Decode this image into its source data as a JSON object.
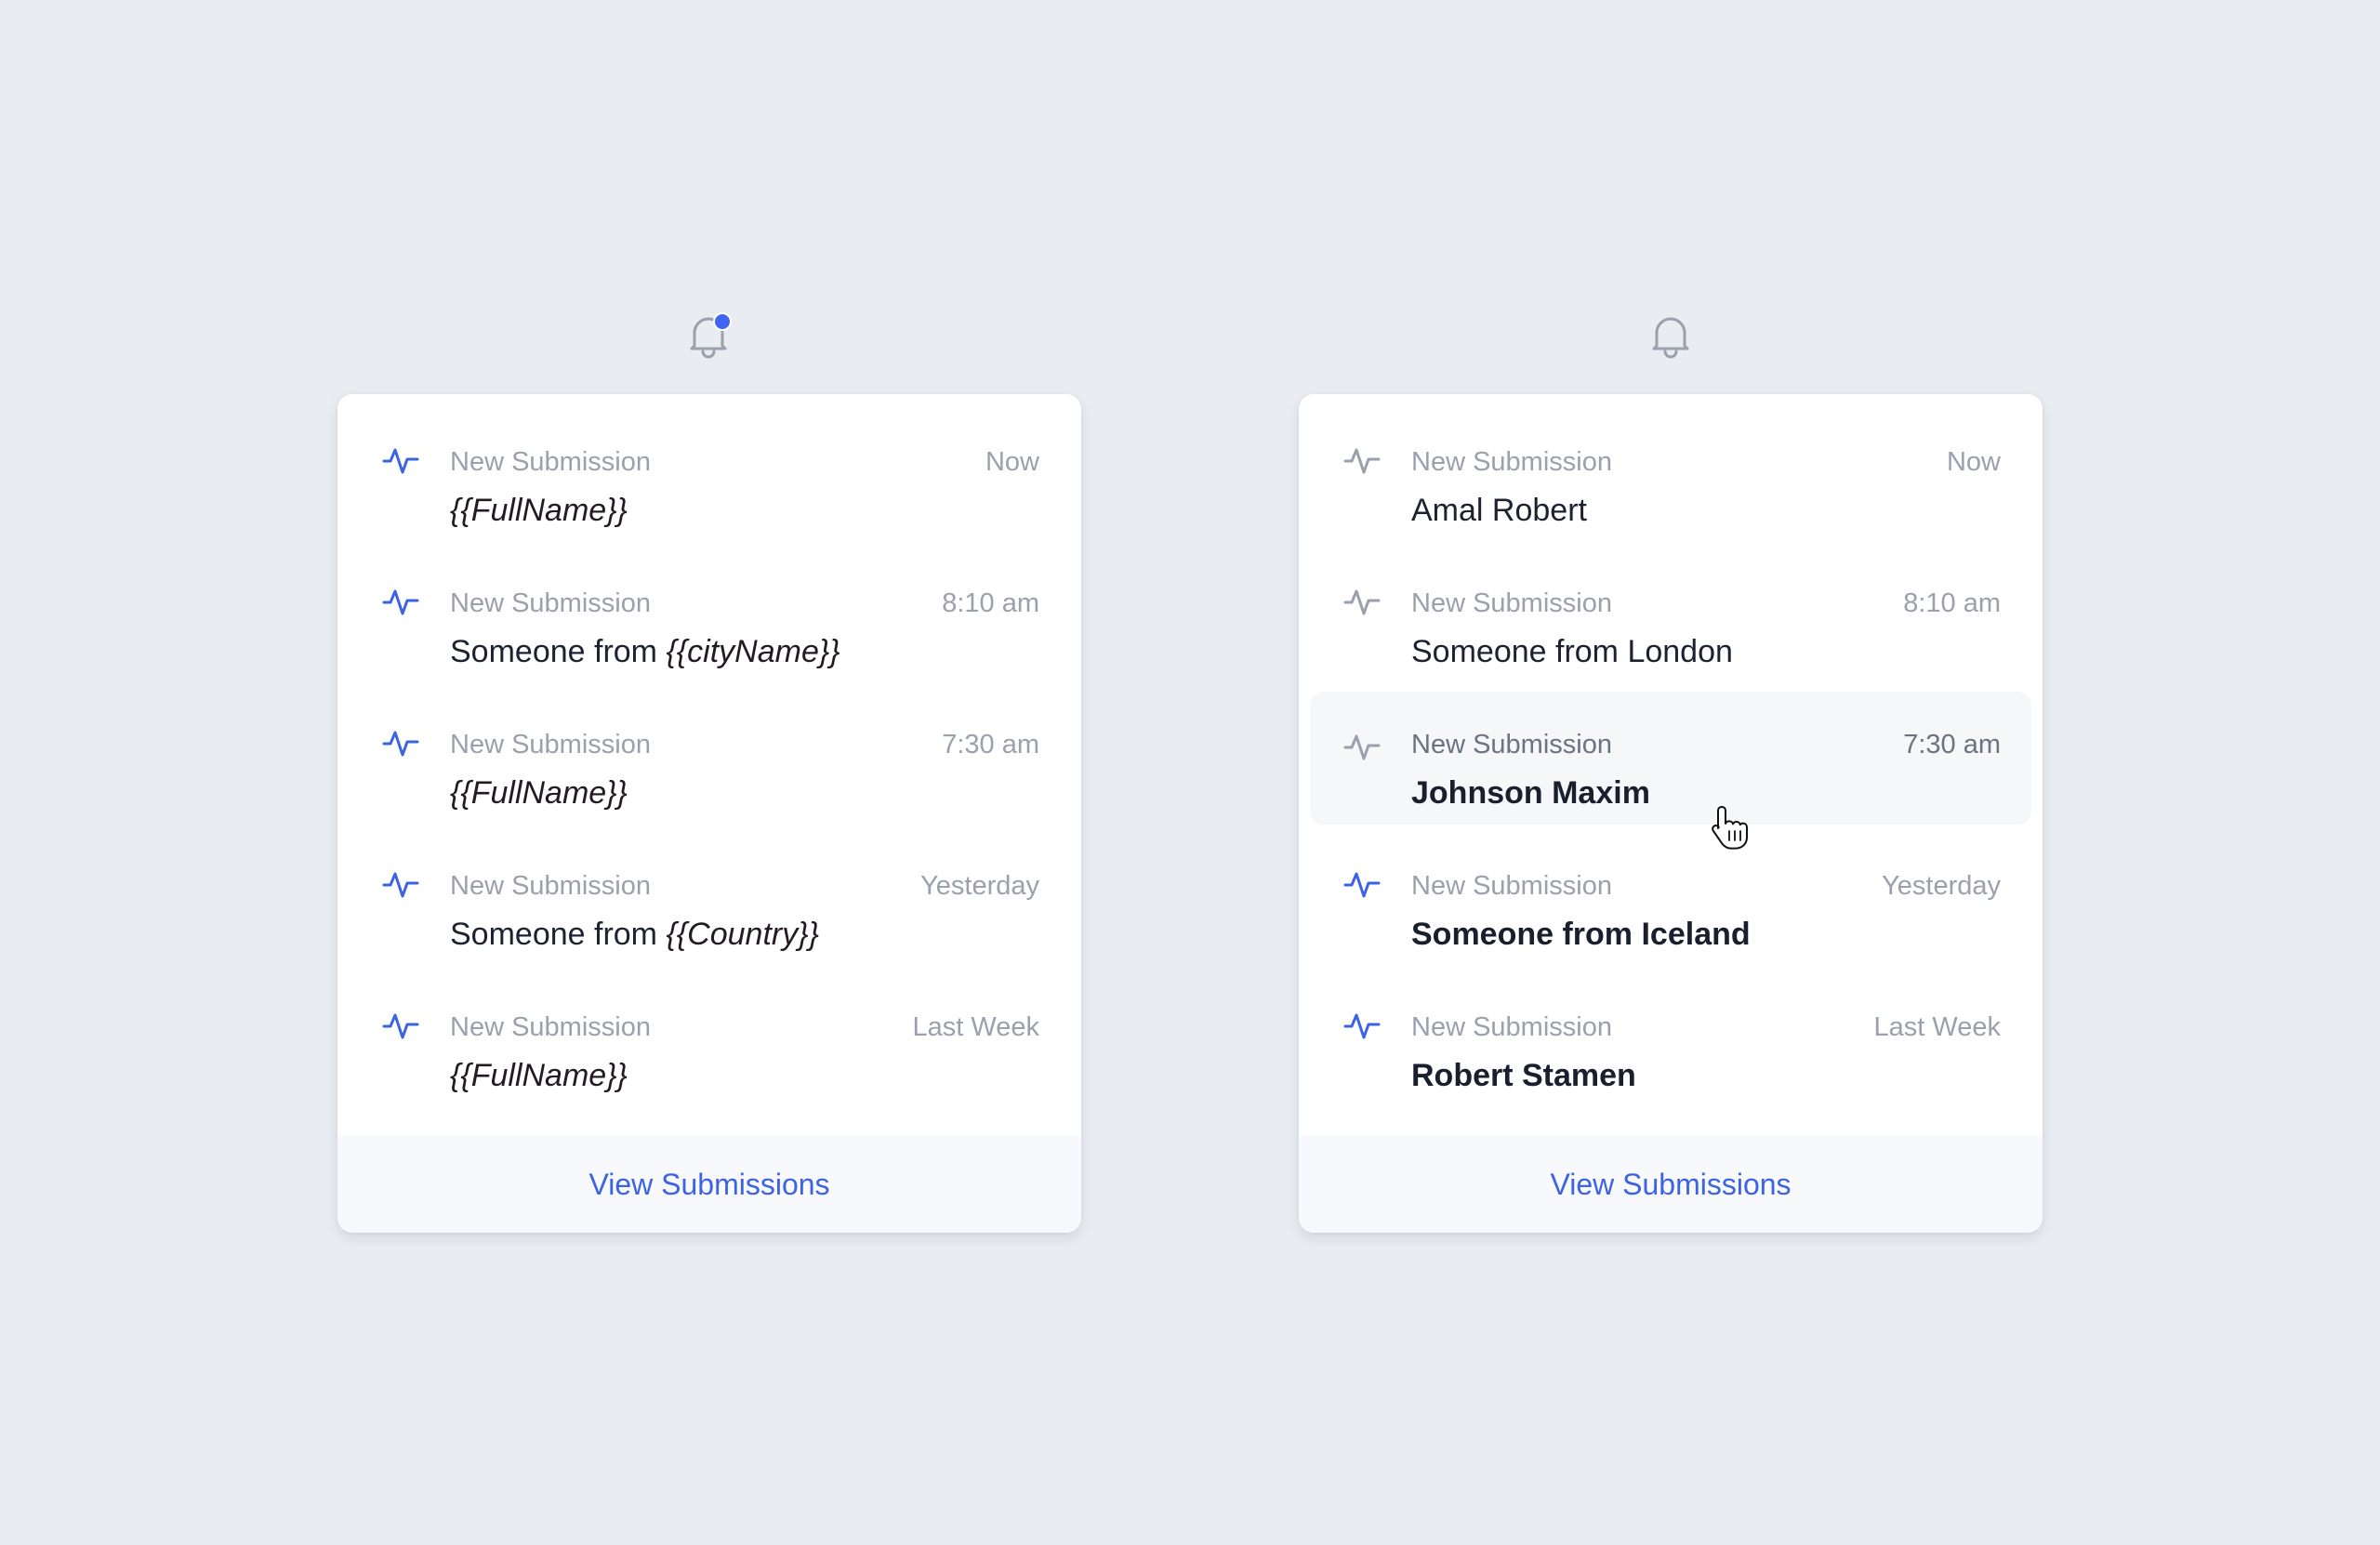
{
  "colors": {
    "background": "#e9ecf1",
    "card": "#ffffff",
    "accent": "#3d63e3",
    "muted": "#9aa0ac",
    "text": "#1d2230",
    "footer_bg": "#f7f9fc",
    "badge": "#3f66f0"
  },
  "panels": [
    {
      "bell_icon": "bell-icon",
      "has_badge": true,
      "items": [
        {
          "label": "New Submission",
          "time": "Now",
          "title_prefix": "",
          "title_var": "{{FullName}}",
          "icon": "activity-pulse-icon",
          "icon_color": "#3d63e3"
        },
        {
          "label": "New Submission",
          "time": "8:10 am",
          "title_prefix": "Someone from ",
          "title_var": "{{cityName}}",
          "icon": "activity-pulse-icon",
          "icon_color": "#3d63e3"
        },
        {
          "label": "New Submission",
          "time": "7:30 am",
          "title_prefix": "",
          "title_var": "{{FullName}}",
          "icon": "activity-pulse-icon",
          "icon_color": "#3d63e3"
        },
        {
          "label": "New Submission",
          "time": "Yesterday",
          "title_prefix": "Someone from ",
          "title_var": "{{Country}}",
          "icon": "activity-pulse-icon",
          "icon_color": "#3d63e3"
        },
        {
          "label": "New Submission",
          "time": "Last Week",
          "title_prefix": "",
          "title_var": "{{FullName}}",
          "icon": "activity-pulse-icon",
          "icon_color": "#3d63e3"
        }
      ],
      "footer_label": "View Submissions"
    },
    {
      "bell_icon": "bell-icon",
      "has_badge": false,
      "items": [
        {
          "label": "New Submission",
          "time": "Now",
          "title": "Amal Robert",
          "icon": "activity-pulse-icon",
          "icon_color": "#9aa0ac"
        },
        {
          "label": "New Submission",
          "time": "8:10 am",
          "title": "Someone from London",
          "icon": "activity-pulse-icon",
          "icon_color": "#9aa0ac"
        },
        {
          "label": "New Submission",
          "time": "7:30 am",
          "title": "Johnson Maxim",
          "icon": "activity-pulse-icon",
          "icon_color": "#9aa0ac",
          "state": "hover"
        },
        {
          "label": "New Submission",
          "time": "Yesterday",
          "title": "Someone from Iceland",
          "icon": "activity-pulse-icon",
          "icon_color": "#3d63e3"
        },
        {
          "label": "New Submission",
          "time": "Last Week",
          "title": "Robert Stamen",
          "icon": "activity-pulse-icon",
          "icon_color": "#3d63e3"
        }
      ],
      "footer_label": "View Submissions"
    }
  ],
  "cursor_icon": "hand-pointer-cursor-icon"
}
